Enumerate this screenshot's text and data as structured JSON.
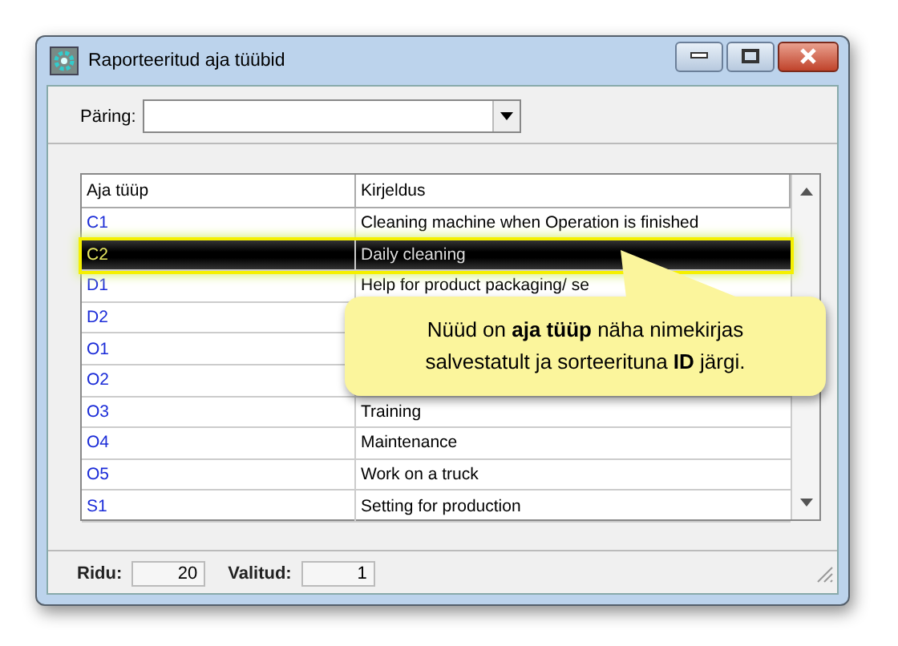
{
  "window": {
    "title": "Raporteeritud aja tüübid"
  },
  "query": {
    "label": "Päring:"
  },
  "table": {
    "columns": [
      "Aja tüüp",
      "Kirjeldus"
    ],
    "rows": [
      {
        "id": "C1",
        "description": "Cleaning machine when Operation is finished",
        "selected": false
      },
      {
        "id": "C2",
        "description": "Daily cleaning",
        "selected": true
      },
      {
        "id": "D1",
        "description": "Help for product packaging/ se",
        "selected": false
      },
      {
        "id": "D2",
        "selected": false
      },
      {
        "id": "O1",
        "selected": false
      },
      {
        "id": "O2",
        "selected": false
      },
      {
        "id": "O3",
        "description": "Training",
        "selected": false
      },
      {
        "id": "O4",
        "description": "Maintenance",
        "selected": false
      },
      {
        "id": "O5",
        "description": "Work on a truck",
        "selected": false
      },
      {
        "id": "S1",
        "description": "Setting for production",
        "selected": false
      }
    ]
  },
  "callout": {
    "text": "Nüüd on **aja tüüp** näha nimekirjas salvestatult ja sorteerituna **ID** järgi."
  },
  "status_bar": [
    {
      "label": "Ridu:",
      "value": "20"
    },
    {
      "label": "Valitud:",
      "value": "1"
    }
  ]
}
